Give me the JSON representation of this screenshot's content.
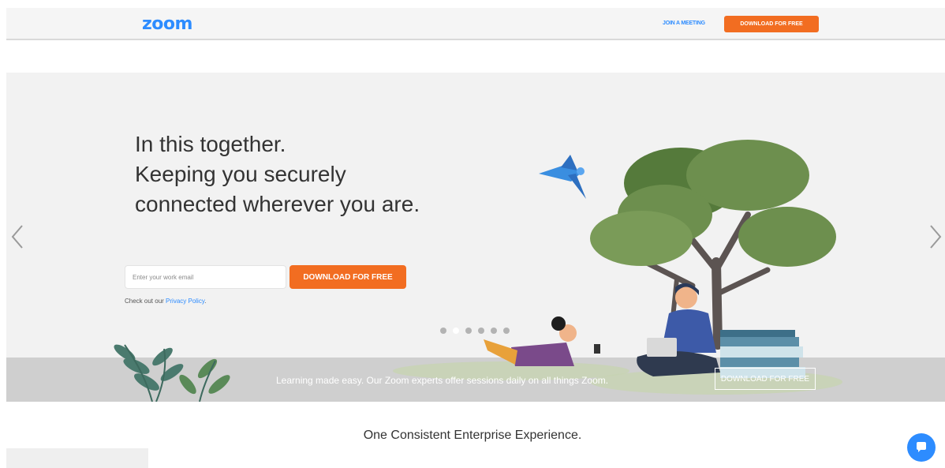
{
  "header": {
    "logo_text": "zoom",
    "join_label": "JOIN A MEETING",
    "download_label": "DOWNLOAD FOR FREE"
  },
  "hero": {
    "title_lines": [
      "In this together.",
      "Keeping you securely",
      "connected wherever you are."
    ],
    "email_placeholder": "Enter your work email",
    "download_label": "DOWNLOAD FOR FREE",
    "privacy_prefix": "Check out our",
    "privacy_link": "Privacy Policy",
    "privacy_suffix": ".",
    "carousel": {
      "slide_count": 6,
      "active_index": 1
    },
    "band_text": "Learning made easy. Our Zoom experts offer sessions daily on all things Zoom.",
    "band_download_label": "DOWNLOAD FOR FREE"
  },
  "section": {
    "title": "One Consistent Enterprise Experience."
  },
  "colors": {
    "brand_blue": "#2d8cff",
    "accent_orange": "#f26d21",
    "hero_bg": "#f2f2f2",
    "band_gray": "#cfcfcf",
    "tree_green": "#6d8f4e",
    "tree_dark_green": "#557a3b",
    "trunk": "#5c5452"
  },
  "icons": {
    "prev": "chevron-left-icon",
    "next": "chevron-right-icon",
    "chat": "chat-bubble-icon"
  }
}
